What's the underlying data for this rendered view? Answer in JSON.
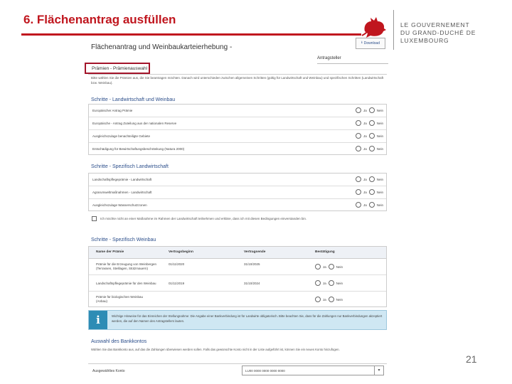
{
  "slide": {
    "title": "6. Flächenantrag ausfüllen",
    "gov_line1": "LE GOUVERNEMENT",
    "gov_line2": "DU GRAND-DUCHÉ DE LUXEMBOURG",
    "page_number": "21",
    "accent_color": "#c0161e"
  },
  "form": {
    "title": "Flächenantrag und Weinbaukartei­erhebung -",
    "download_label": "Download",
    "applicant_label": "Antragsteller",
    "active_tab": "Prämien - Prämienauswahl",
    "intro": "Bitte wählen Sie die Prämien aus, die Sie beantragen möchten. Danach wird unterschieden zwischen allgemeinen Schritten (gültig für Landwirtschaft und Weinbau) und spezifischen Schritten (Landwirtschaft bzw. Weinbau)."
  },
  "section1": {
    "heading": "Schritte - Landwirtschaft und Weinbau",
    "rows": [
      {
        "label": "Europäischer Antrag Prämie"
      },
      {
        "label": "Europäische - Antrag Zuteilung aus der nationalen Reserve"
      },
      {
        "label": "Ausgleichszulage benachteiligte Gebiete"
      },
      {
        "label": "Entschädigung für Bewirtschaftungsbeschränkung (Natura 2000)"
      }
    ],
    "yes": "Ja",
    "no": "Nein"
  },
  "section2": {
    "heading": "Schritte - Spezifisch Landwirtschaft",
    "rows": [
      {
        "label": "Landschaftspflegeprämie - Landwirtschaft"
      },
      {
        "label": "Agrarumweltmaßnahmen - Landwirtschaft"
      },
      {
        "label": "Ausgleichszulage Wasserschutzzonen"
      }
    ],
    "yes": "Ja",
    "no": "Nein",
    "checkbox_text": "Ich möchte nicht an einer Maßnahme im Rahmen der Landwirtschaft teilnehmen und erkläre, dass ich mit diesen Bedingungen einverstanden bin."
  },
  "section3": {
    "heading": "Schritte - Spezifisch Weinbau",
    "columns": [
      "Name der Prämie",
      "Vertragsbeginn",
      "Vertragsende",
      "Bestätigung"
    ],
    "rows": [
      {
        "name_l1": "Prämie für die Erzeugung von Weinbergen",
        "name_l2": "(Terrassen, Steillagen, Stützmauern)",
        "start": "01/11/2020",
        "end": "31/10/2025"
      },
      {
        "name_l1": "Landschaftspflegeprämie für den Weinbau",
        "name_l2": "",
        "start": "01/11/2019",
        "end": "31/10/2024"
      },
      {
        "name_l1": "Prämie für biologischen Weinbau",
        "name_l2": "(Anbau)",
        "start": "",
        "end": ""
      }
    ],
    "yes": "Ja",
    "no": "Nein"
  },
  "info": {
    "icon": "i",
    "text": "Wichtige Hinweise für das Einreichen der Stellungnahme: Die Angabe einer Bankverbindung ist für Landwirte obligatorisch. Bitte beachten Sie, dass für die Zahlungen nur Bankverbindungen akzeptiert werden, die auf den Namen des Antragstellers lauten."
  },
  "bank": {
    "heading": "Auswahl des Bankkontos",
    "text": "Wählen Sie das Bankkonto aus, auf das die Zahlungen überwiesen werden sollen. Falls das gewünschte Konto nicht in der Liste aufgeführt ist, können Sie ein neues Konto hinzufügen.",
    "select_label": "Ausgewähltes Konto",
    "select_value": "LU00 0000 0000 0000 0000"
  }
}
